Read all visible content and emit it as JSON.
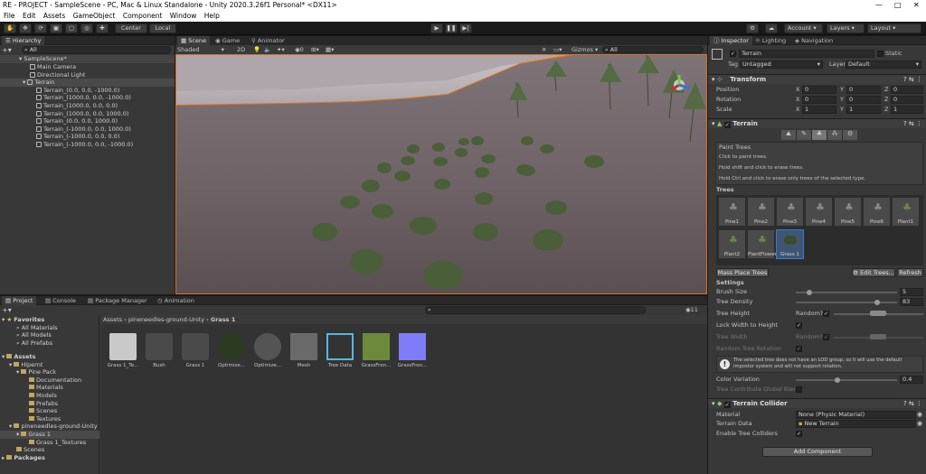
{
  "window": {
    "title": "RE - PROJECT - SampleScene - PC, Mac & Linux Standalone - Unity 2020.3.26f1 Personal* <DX11>"
  },
  "menu": [
    "File",
    "Edit",
    "Assets",
    "GameObject",
    "Component",
    "Window",
    "Help"
  ],
  "toolbar": {
    "center": "Center",
    "local": "Local",
    "account": "Account",
    "layers": "Layers",
    "layout": "Layout"
  },
  "hierarchy": {
    "tab": "Hierarchy",
    "search": "All",
    "scene": "SampleScene*",
    "items": [
      "Main Camera",
      "Directional Light",
      "Terrain"
    ],
    "children": [
      "Terrain_(0.0, 0.0, -1000.0)",
      "Terrain_(1000.0, 0.0, -1000.0)",
      "Terrain_(1000.0, 0.0, 0.0)",
      "Terrain_(1000.0, 0.0, 1000.0)",
      "Terrain_(0.0, 0.0, 1000.0)",
      "Terrain_(-1000.0, 0.0, 1000.0)",
      "Terrain_(-1000.0, 0.0, 0.0)",
      "Terrain_(-1000.0, 0.0, -1000.0)"
    ]
  },
  "scene_view": {
    "tabs": [
      "Scene",
      "Game",
      "Animator"
    ],
    "shading": "Shaded",
    "mode": "2D",
    "gizmos": "Gizmos",
    "search": "All",
    "fx_count": "0"
  },
  "project": {
    "tabs": [
      "Project",
      "Console",
      "Package Manager",
      "Animation"
    ],
    "breadcrumb": [
      "Assets",
      "pineneedles-ground-Unity",
      "Grass 1"
    ],
    "count": "11",
    "favorites_label": "Favorites",
    "favorites": [
      "All Materials",
      "All Models",
      "All Prefabs"
    ],
    "assets_label": "Assets",
    "tree": [
      "Hipernt",
      "Pine Pack",
      "Documentation",
      "Materials",
      "Models",
      "Prefabs",
      "Scenes",
      "Textures",
      "pineneedles-ground-Unity",
      "Grass 1",
      "Grass 1_Textures",
      "Scenes"
    ],
    "packages_label": "Packages",
    "files": [
      "Grass 1_Te...",
      "Bush",
      "Grass 1",
      "Optimize...",
      "Optimize...",
      "Mesh",
      "Tree Data",
      "GrassFron...",
      "GrassFron..."
    ]
  },
  "inspector": {
    "tabs": [
      "Inspector",
      "Lighting",
      "Navigation"
    ],
    "object_name": "Terrain",
    "static_label": "Static",
    "tag_label": "Tag",
    "tag_value": "Untagged",
    "layer_label": "Layer",
    "layer_value": "Default",
    "transform": {
      "title": "Transform",
      "rows": [
        {
          "label": "Position",
          "x": "0",
          "y": "0",
          "z": "0"
        },
        {
          "label": "Rotation",
          "x": "0",
          "y": "0",
          "z": "0"
        },
        {
          "label": "Scale",
          "x": "1",
          "y": "1",
          "z": "1"
        }
      ]
    },
    "terrain": {
      "title": "Terrain",
      "paint_title": "Paint Trees",
      "hints": [
        "Click to paint trees.",
        "Hold shift and click to erase trees.",
        "Hold Ctrl and click to erase only trees of the selected type."
      ],
      "trees_label": "Trees",
      "trees": [
        "Pine1",
        "Pine2",
        "Pine3",
        "Pine4",
        "Pine5",
        "Pine6",
        "Plant1",
        "Plant2",
        "PlantFlower",
        "Grass 1"
      ],
      "mass_place": "Mass Place Trees",
      "edit_trees": "Edit Trees...",
      "refresh": "Refresh",
      "settings_label": "Settings",
      "brush_size_label": "Brush Size",
      "brush_size": "5",
      "tree_density_label": "Tree Density",
      "tree_density": "83",
      "tree_height_label": "Tree Height",
      "random_label": "Random?",
      "lock_width_label": "Lock Width to Height",
      "tree_width_label": "Tree Width",
      "random_rotation_label": "Random Tree Rotation",
      "info": "The selected tree does not have an LOD group, so it will use the default impostor system and will not support rotation.",
      "color_variation_label": "Color Variation",
      "color_variation": "0.4",
      "global_blend_label": "Tree Contribute Global Blend"
    },
    "collider": {
      "title": "Terrain Collider",
      "material_label": "Material",
      "material": "None (Physic Material)",
      "data_label": "Terrain Data",
      "data": "New Terrain",
      "enable_label": "Enable Tree Colliders"
    },
    "add_component": "Add Component"
  }
}
